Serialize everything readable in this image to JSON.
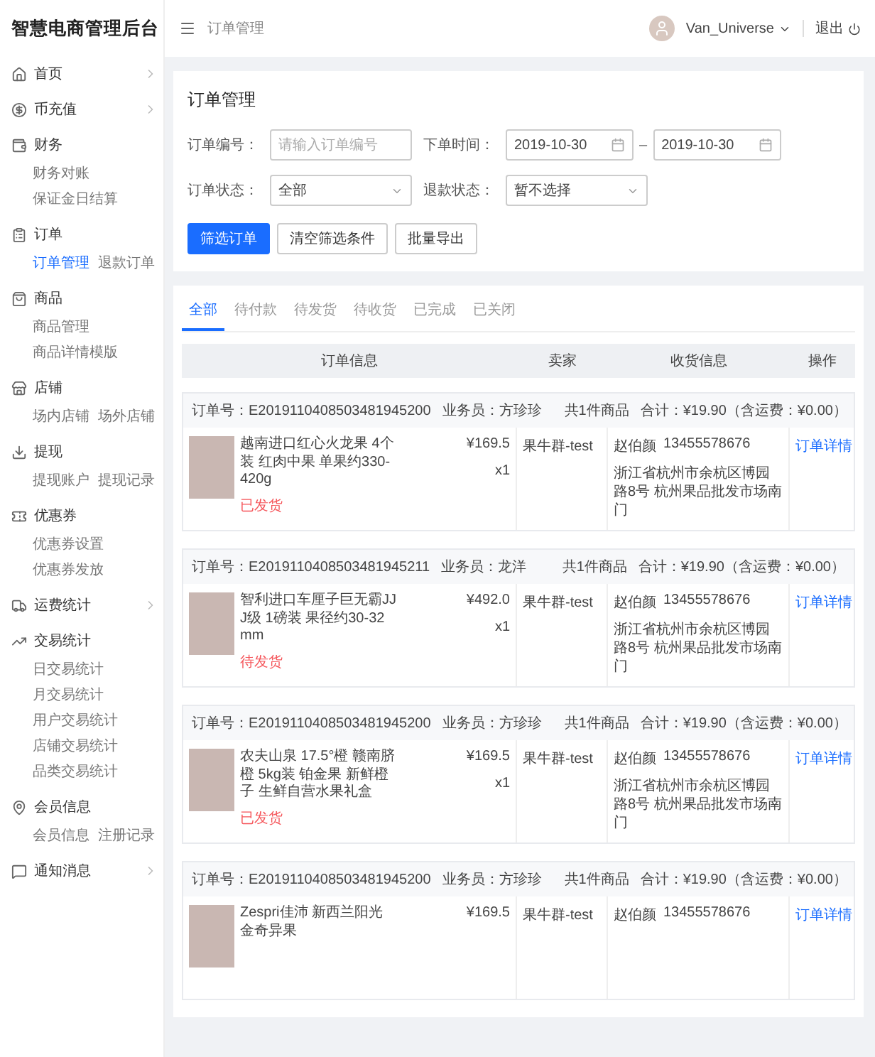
{
  "app": {
    "title": "智慧电商管理后台"
  },
  "sidebar": {
    "sections": [
      {
        "label": "首页",
        "has_arrow": true
      },
      {
        "label": "币充值",
        "has_arrow": true
      },
      {
        "label": "财务",
        "has_arrow": false,
        "children": [
          {
            "label": "财务对账",
            "selected": false
          },
          {
            "label": "保证金日结算",
            "selected": false
          }
        ]
      },
      {
        "label": "订单",
        "has_arrow": false,
        "children": [
          {
            "label": "订单管理",
            "selected": true
          },
          {
            "label": "退款订单",
            "selected": false
          }
        ]
      },
      {
        "label": "商品",
        "has_arrow": false,
        "children": [
          {
            "label": "商品管理",
            "selected": false
          },
          {
            "label": "商品详情模版",
            "selected": false
          }
        ]
      },
      {
        "label": "店铺",
        "has_arrow": false,
        "children": [
          {
            "label": "场内店铺",
            "selected": false
          },
          {
            "label": "场外店铺",
            "selected": false
          }
        ]
      },
      {
        "label": "提现",
        "has_arrow": false,
        "children": [
          {
            "label": "提现账户",
            "selected": false
          },
          {
            "label": "提现记录",
            "selected": false
          }
        ]
      },
      {
        "label": "优惠券",
        "has_arrow": false,
        "children": [
          {
            "label": "优惠券设置",
            "selected": false
          },
          {
            "label": "优惠券发放",
            "selected": false
          }
        ]
      },
      {
        "label": "运费统计",
        "has_arrow": true
      },
      {
        "label": "交易统计",
        "has_arrow": false,
        "children": [
          {
            "label": "日交易统计",
            "selected": false
          },
          {
            "label": "月交易统计",
            "selected": false
          },
          {
            "label": "用户交易统计",
            "selected": false
          },
          {
            "label": "店铺交易统计",
            "selected": false
          },
          {
            "label": "品类交易统计",
            "selected": false
          }
        ]
      },
      {
        "label": "会员信息",
        "has_arrow": false,
        "children": [
          {
            "label": "会员信息",
            "selected": false
          },
          {
            "label": "注册记录",
            "selected": false
          }
        ]
      },
      {
        "label": "通知消息",
        "has_arrow": true
      }
    ]
  },
  "topbar": {
    "breadcrumb": "订单管理",
    "user": "Van_Universe",
    "logout": "退出"
  },
  "filter": {
    "title": "订单管理",
    "fields": [
      {
        "kind": "text",
        "label": "订单编号：",
        "placeholder": "请输入订单编号"
      },
      {
        "kind": "daterange",
        "label": "下单时间：",
        "start": "2019-10-30",
        "separator": "–",
        "end": "2019-10-30"
      },
      {
        "kind": "select",
        "label": "订单状态：",
        "value": "全部"
      },
      {
        "kind": "select",
        "label": "退款状态：",
        "value": "暂不选择"
      }
    ],
    "buttons": [
      {
        "label": "筛选订单",
        "primary": true
      },
      {
        "label": "清空筛选条件",
        "primary": false
      },
      {
        "label": "批量导出",
        "primary": false
      }
    ]
  },
  "tabs": [
    {
      "label": "全部",
      "selected": true
    },
    {
      "label": "待付款",
      "selected": false
    },
    {
      "label": "待发货",
      "selected": false
    },
    {
      "label": "待收货",
      "selected": false
    },
    {
      "label": "已完成",
      "selected": false
    },
    {
      "label": "已关闭",
      "selected": false
    }
  ],
  "table": {
    "columns": [
      "订单信息",
      "卖家",
      "收货信息",
      "操作"
    ]
  },
  "orders": [
    {
      "order_no": "订单号：E20191104085034819452​00",
      "salesperson": "业务员：方珍珍",
      "count": "共1件商品",
      "total": "合计：¥19.90（含运费：¥0.00）",
      "product": {
        "name": "越南进口红心火龙果 4个装 红肉中果 单果约330-420g",
        "price": "¥169.5",
        "qty": "x1",
        "status": "已发货"
      },
      "seller": "果牛群-test",
      "receiver": "赵伯颜",
      "phone": "13455578676",
      "address": "浙江省杭州市余杭区博园路8号 杭州果品批发市场南门",
      "action": "订单详情"
    },
    {
      "order_no": "订单号：E20191104085034819452​11",
      "salesperson": "业务员：龙洋",
      "count": "共1件商品",
      "total": "合计：¥19.90（含运费：¥0.00）",
      "product": {
        "name": "智利进口车厘子巨无霸JJJ级 1磅装 果径约30-32mm",
        "price": "¥492.0",
        "qty": "x1",
        "status": "待发货"
      },
      "seller": "果牛群-test",
      "receiver": "赵伯颜",
      "phone": "13455578676",
      "address": "浙江省杭州市余杭区博园路8号 杭州果品批发市场南门",
      "action": "订单详情"
    },
    {
      "order_no": "订单号：E20191104085034819452​00",
      "salesperson": "业务员：方珍珍",
      "count": "共1件商品",
      "total": "合计：¥19.90（含运费：¥0.00）",
      "product": {
        "name": "农夫山泉 17.5°橙 赣南脐橙 5kg装 铂金果 新鲜橙子 生鲜自营水果礼盒",
        "price": "¥169.5",
        "qty": "x1",
        "status": "已发货"
      },
      "seller": "果牛群-test",
      "receiver": "赵伯颜",
      "phone": "13455578676",
      "address": "浙江省杭州市余杭区博园路8号 杭州果品批发市场南门",
      "action": "订单详情"
    },
    {
      "order_no": "订单号：E20191104085034819452​00",
      "salesperson": "业务员：方珍珍",
      "count": "共1件商品",
      "total": "合计：¥19.90（含运费：¥0.00）",
      "product": {
        "name": "Zespri佳沛 新西兰阳光金奇异果",
        "price": "¥169.5"
      },
      "seller": "果牛群-test",
      "receiver": "赵伯颜",
      "phone": "13455578676",
      "action": "订单详情"
    }
  ]
}
